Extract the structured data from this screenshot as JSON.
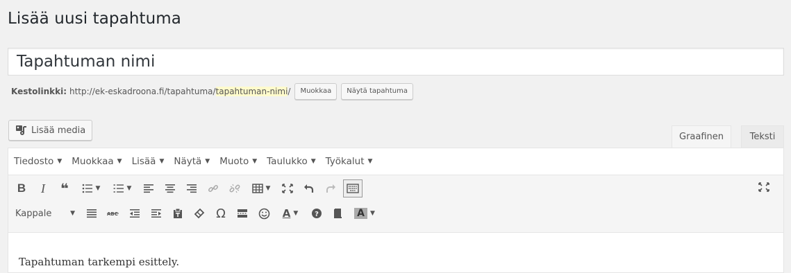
{
  "page": {
    "title": "Lisää uusi tapahtuma"
  },
  "post": {
    "title_value": "Tapahtuman nimi"
  },
  "permalink": {
    "label": "Kestolinkki:",
    "base_url": "http://ek-eskadroona.fi/tapahtuma/",
    "slug": "tapahtuman-nimi",
    "trailing": "/",
    "edit_label": "Muokkaa",
    "view_label": "Näytä tapahtuma"
  },
  "media": {
    "add_label": "Lisää media",
    "icon": "media-icon"
  },
  "editor_tabs": {
    "visual": "Graafinen",
    "text": "Teksti"
  },
  "menubar": [
    {
      "label": "Tiedosto",
      "caret": "▼"
    },
    {
      "label": "Muokkaa",
      "caret": "▼"
    },
    {
      "label": "Lisää",
      "caret": "▼"
    },
    {
      "label": "Näytä",
      "caret": "▼"
    },
    {
      "label": "Muoto",
      "caret": "▼"
    },
    {
      "label": "Taulukko",
      "caret": "▼"
    },
    {
      "label": "Työkalut",
      "caret": "▼"
    }
  ],
  "toolbar": {
    "bold": "B",
    "italic": "I",
    "quote": "❝",
    "format_select": "Kappale",
    "omega": "Ω",
    "text_color": "A",
    "bg_color": "A",
    "caret": "▼"
  },
  "content": {
    "text": "Tapahtuman tarkempi esittely."
  }
}
